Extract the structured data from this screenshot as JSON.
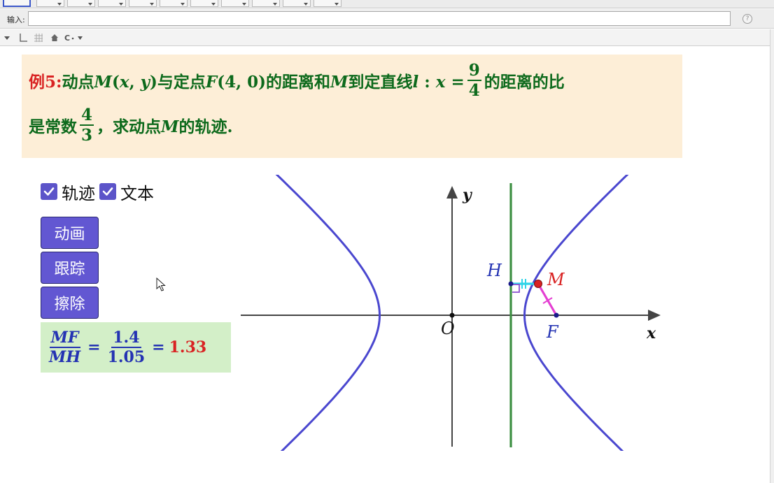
{
  "input_bar": {
    "label": "输入:",
    "value": "",
    "help": "?"
  },
  "problem": {
    "label": "例5:",
    "line1": [
      {
        "t": "动点"
      },
      {
        "t": "M",
        "i": true
      },
      {
        "t": "("
      },
      {
        "t": "x",
        "i": true
      },
      {
        "t": ", "
      },
      {
        "t": "y",
        "i": true
      },
      {
        "t": ")与定点"
      },
      {
        "t": "F",
        "i": true
      },
      {
        "t": "(4, 0)的距离和"
      },
      {
        "t": "M",
        "i": true
      },
      {
        "t": "到定直线"
      },
      {
        "t": "l",
        "i": true
      },
      {
        "t": " : "
      },
      {
        "t": "x",
        "i": true
      },
      {
        "t": " = "
      }
    ],
    "frac1": {
      "num": "9",
      "den": "4"
    },
    "line1_tail": "的距离的比",
    "line2_head": "是常数",
    "frac2": {
      "num": "4",
      "den": "3"
    },
    "line2_tail": [
      {
        "t": "，求动点"
      },
      {
        "t": "M",
        "i": true
      },
      {
        "t": "的轨迹."
      }
    ]
  },
  "controls": {
    "checkbox_trace_label": "轨迹",
    "checkbox_text_label": "文本",
    "checkbox_trace_checked": true,
    "checkbox_text_checked": true,
    "buttons": [
      "动画",
      "跟踪",
      "擦除"
    ]
  },
  "ratio": {
    "numerator": "MF",
    "denominator": "MH",
    "eq": "=",
    "num_value": "1.4",
    "den_value": "1.05",
    "result": "1.33"
  },
  "graph": {
    "x_axis_label": "x",
    "y_axis_label": "y",
    "origin_label": "O",
    "point_H": "H",
    "point_M": "M",
    "point_F": "F",
    "colors": {
      "hyperbola": "#4a47cf",
      "directrix": "#3d8f42",
      "point_M": "#d92323",
      "segment_MF": "#e43fd2",
      "segment_MH": "#2fd4e8"
    }
  }
}
